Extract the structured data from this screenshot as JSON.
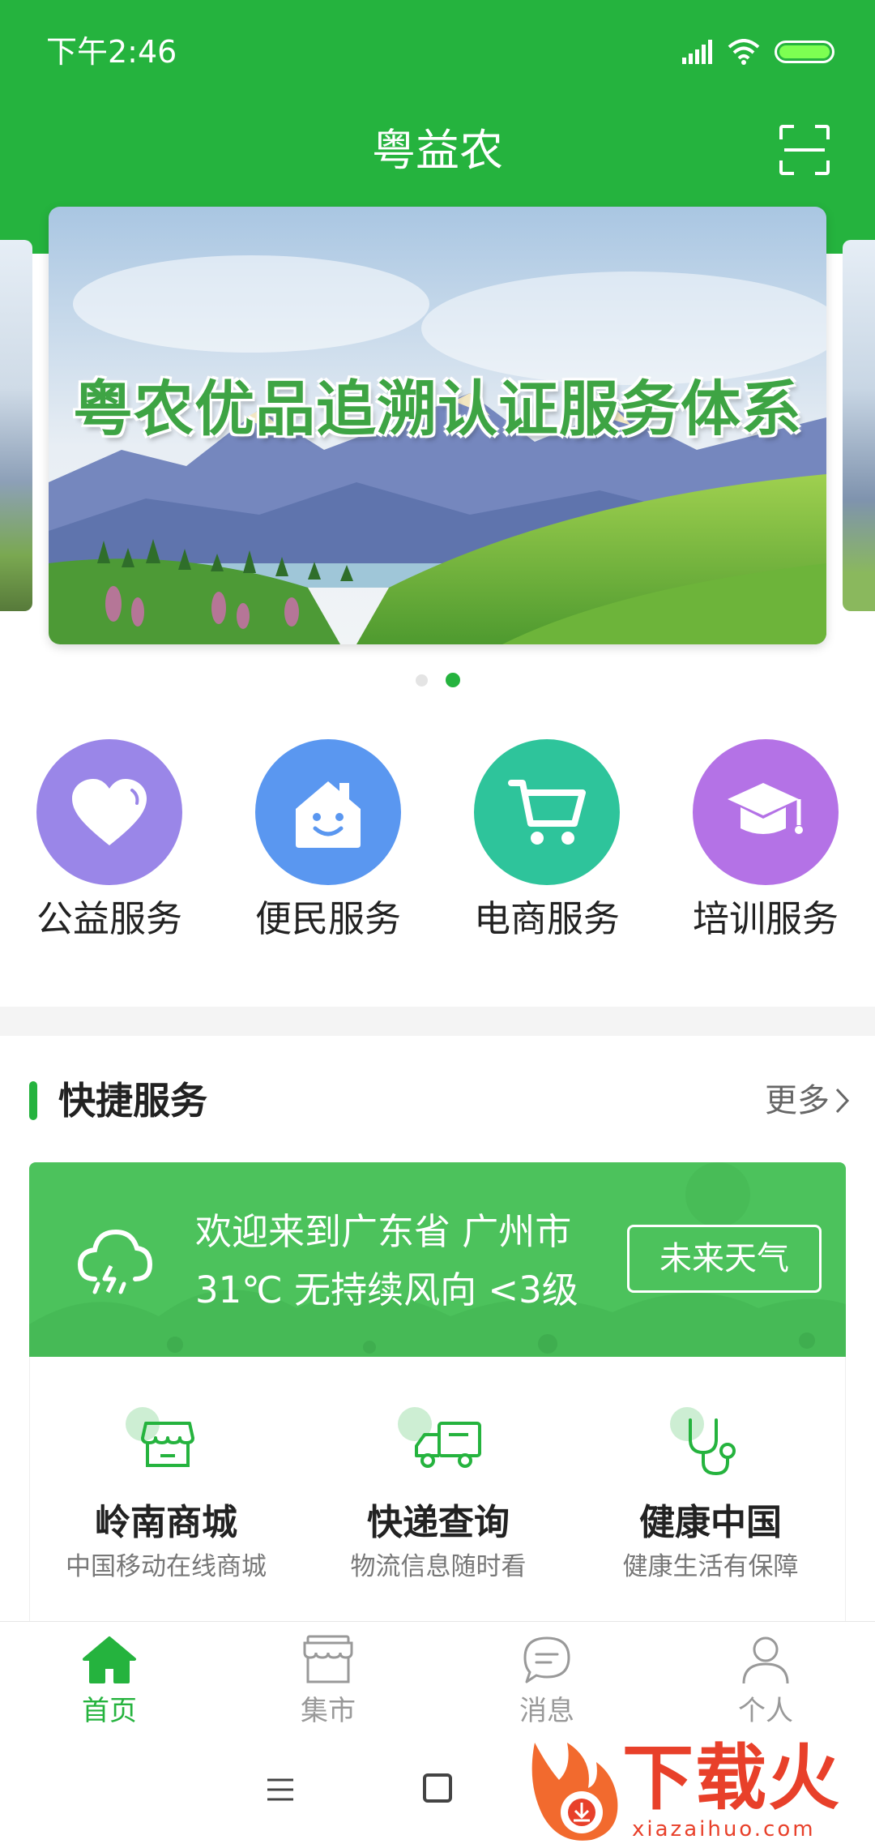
{
  "status_bar": {
    "time": "下午2:46"
  },
  "header": {
    "title": "粤益农"
  },
  "banner": {
    "headline": "粤农优品追溯认证服务体系",
    "dot_count": 2,
    "active_index": 1
  },
  "services": [
    {
      "label": "公益服务",
      "icon": "heart-icon",
      "color": "#9a86e8"
    },
    {
      "label": "便民服务",
      "icon": "house-smile-icon",
      "color": "#5a97f0"
    },
    {
      "label": "电商服务",
      "icon": "cart-icon",
      "color": "#2ec49b"
    },
    {
      "label": "培训服务",
      "icon": "graduation-cap-icon",
      "color": "#b472e6"
    }
  ],
  "quick_section": {
    "title": "快捷服务",
    "more": "更多"
  },
  "weather": {
    "line1": "欢迎来到广东省 广州市",
    "line2": "31℃ 无持续风向 <3级",
    "button": "未来天气"
  },
  "quick_items": [
    {
      "title": "岭南商城",
      "subtitle": "中国移动在线商城",
      "icon": "store-icon"
    },
    {
      "title": "快递查询",
      "subtitle": "物流信息随时看",
      "icon": "truck-icon"
    },
    {
      "title": "健康中国",
      "subtitle": "健康生活有保障",
      "icon": "stethoscope-icon"
    }
  ],
  "tabbar": [
    {
      "label": "首页",
      "icon": "home-icon",
      "active": true
    },
    {
      "label": "集市",
      "icon": "market-icon",
      "active": false
    },
    {
      "label": "消息",
      "icon": "message-icon",
      "active": false
    },
    {
      "label": "个人",
      "icon": "user-icon",
      "active": false
    }
  ],
  "watermark": {
    "text": "下载火",
    "url": "xiazaihuo.com"
  },
  "colors": {
    "brand_green": "#25b33e",
    "weather_green": "#4cc25c"
  }
}
